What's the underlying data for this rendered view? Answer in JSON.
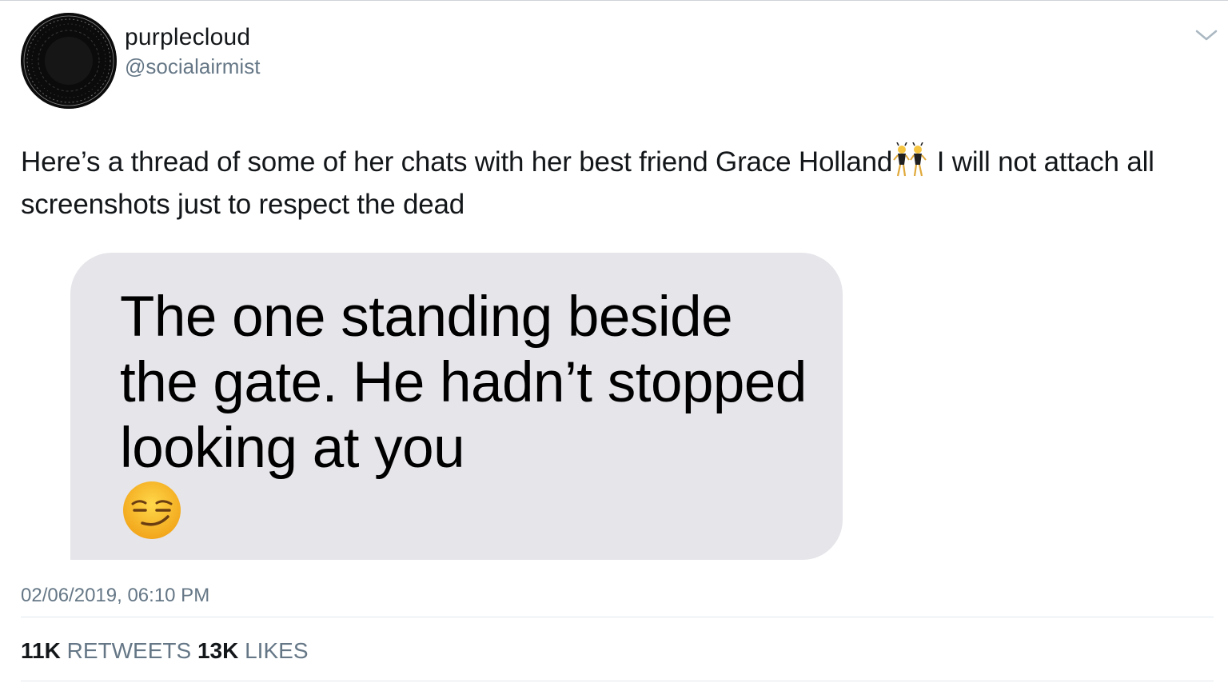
{
  "user": {
    "display_name": "purplecloud",
    "handle": "@socialairmist",
    "avatar_icon": "dark-circle-avatar"
  },
  "menu_icon": "chevron-down-icon",
  "tweet": {
    "text_part1": "Here’s a thread of some of her chats with her best friend Grace Holland",
    "emoji_inline": "dancing-women-emoji",
    "text_part2": " I will not attach all screenshots just to respect the dead"
  },
  "media": {
    "message_text": "The one standing beside the gate. He hadn’t stopped looking at you",
    "emoji": "smirking-face-emoji",
    "bubble_color": "#e5e5ea"
  },
  "timestamp": "02/06/2019, 06:10 PM",
  "stats": {
    "retweets_count": "11K",
    "retweets_label": "RETWEETS",
    "likes_count": "13K",
    "likes_label": "LIKES"
  },
  "colors": {
    "text_primary": "#14171a",
    "text_secondary": "#657786",
    "divider": "#e1e8ed"
  }
}
